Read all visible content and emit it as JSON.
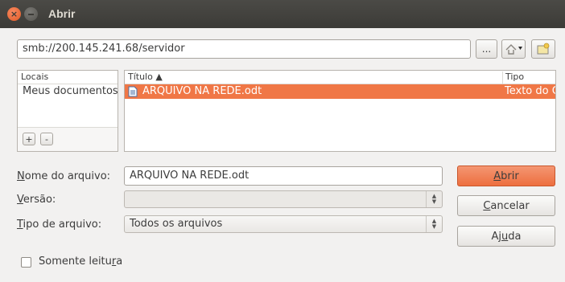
{
  "window": {
    "title": "Abrir"
  },
  "location": {
    "value": "smb://200.145.241.68/servidor",
    "browse_label": "..."
  },
  "places": {
    "header": "Locais",
    "items": [
      {
        "label": "Meus documentos"
      }
    ],
    "add_label": "+",
    "remove_label": "-"
  },
  "files": {
    "columns": {
      "title": "Título ▲",
      "type": "Tipo"
    },
    "rows": [
      {
        "name": "ARQUIVO NA REDE.odt",
        "type": "Texto do OpenDocument",
        "selected": true
      }
    ]
  },
  "form": {
    "filename_label_u": "N",
    "filename_label_rest": "ome do arquivo:",
    "filename_value": "ARQUIVO NA REDE.odt",
    "version_label_u": "V",
    "version_label_rest": "ersão:",
    "version_value": "",
    "filetype_label_u": "T",
    "filetype_label_rest": "ipo de arquivo:",
    "filetype_value": "Todos os arquivos",
    "readonly_label_pre": "Somente leitu",
    "readonly_label_u": "r",
    "readonly_label_post": "a",
    "readonly_checked": false
  },
  "buttons": {
    "open_u": "A",
    "open_rest": "brir",
    "cancel_u": "C",
    "cancel_rest": "ancelar",
    "help_pre": "Aj",
    "help_u": "u",
    "help_post": "da"
  },
  "colors": {
    "accent": "#f07746",
    "titlebar": "#3c3b37"
  }
}
